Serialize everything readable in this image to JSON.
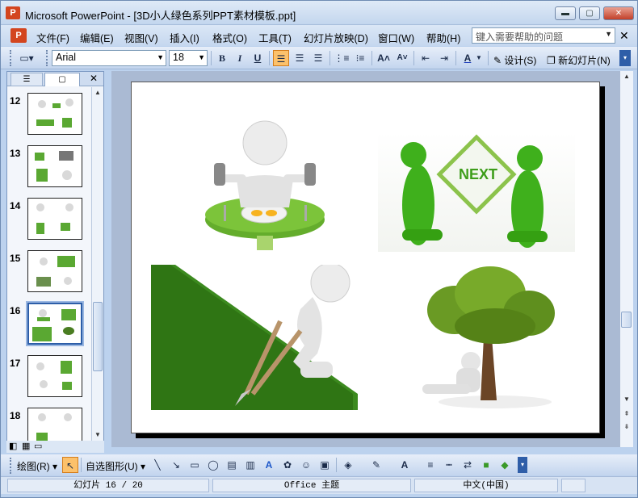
{
  "window": {
    "title": "Microsoft PowerPoint - [3D小人绿色系列PPT素材模板.ppt]",
    "app_icon": "P",
    "controls": [
      "minimize-icon",
      "restore-icon",
      "close-icon"
    ]
  },
  "menubar": {
    "items": [
      "文件(F)",
      "编辑(E)",
      "视图(V)",
      "插入(I)",
      "格式(O)",
      "工具(T)",
      "幻灯片放映(D)",
      "窗口(W)",
      "帮助(H)"
    ],
    "help_placeholder": "键入需要帮助的问题"
  },
  "format_toolbar": {
    "font": "Arial",
    "size": "18",
    "bold": "B",
    "italic": "I",
    "underline": "U",
    "design_label": "设计(S)",
    "new_slide_label": "新幻灯片(N)"
  },
  "slides_pane": {
    "tabs": [
      "outline-tab",
      "slides-tab"
    ],
    "thumbnails": [
      {
        "number": "12",
        "selected": false
      },
      {
        "number": "13",
        "selected": false
      },
      {
        "number": "14",
        "selected": false
      },
      {
        "number": "15",
        "selected": false
      },
      {
        "number": "16",
        "selected": true
      },
      {
        "number": "17",
        "selected": false
      },
      {
        "number": "18",
        "selected": false
      }
    ]
  },
  "slide": {
    "next_sign": "NEXT"
  },
  "draw_toolbar": {
    "draw_label": "绘图(R)",
    "autoshapes_label": "自选图形(U)"
  },
  "statusbar": {
    "slide_info": "幻灯片 16 / 20",
    "theme": "Office 主题",
    "language": "中文(中国)"
  }
}
